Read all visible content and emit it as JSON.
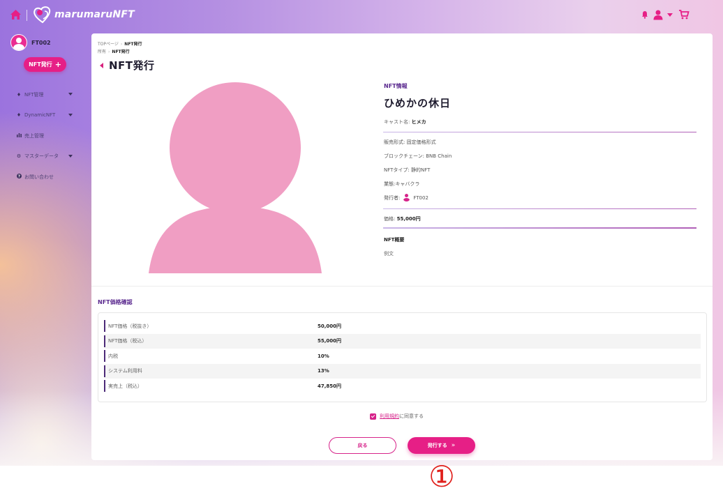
{
  "header": {
    "logo_text": "marumaruNFT",
    "icons": [
      "home-icon",
      "bell-icon",
      "user-icon",
      "cart-icon"
    ],
    "accent_color": "#e61f86"
  },
  "sidebar": {
    "username": "FT002",
    "issue_button_label": "NFT発行",
    "issue_button_icon": "+",
    "items": [
      {
        "label": "NFT管理",
        "icon": "diamond-icon",
        "has_caret": true
      },
      {
        "label": "DynamicNFT",
        "icon": "diamond-icon",
        "has_caret": true
      },
      {
        "label": "売上管理",
        "icon": "bar-chart-icon",
        "has_caret": false
      },
      {
        "label": "マスターデータ",
        "icon": "gear-icon",
        "has_caret": true
      },
      {
        "label": "お問い合わせ",
        "icon": "question-icon",
        "has_caret": false
      }
    ]
  },
  "breadcrumb": {
    "top": "TOPページ",
    "current": "NFT発行",
    "owner_label": "所有",
    "owner_current": "NFT発行"
  },
  "page_title": "NFT発行",
  "nft": {
    "section_heading": "NFT情報",
    "name": "ひめかの休日",
    "cast_label": "キャスト名:",
    "cast_value": "ヒメカ",
    "sale_format": "販売形式: 固定価格形式",
    "blockchain": "ブロックチェーン: BNB Chain",
    "nft_type": "NFTタイプ: 静的NFT",
    "industry": "業態:キャバクラ",
    "issuer_label": "発行者:",
    "issuer_value": "FT002",
    "price_label": "価格:",
    "price_value": "55,000円",
    "summary_heading": "NFT概要",
    "summary_text": "例文",
    "image_color": "#f09ec3"
  },
  "price_confirm": {
    "heading": "NFT価格確認",
    "rows": [
      {
        "label": "NFT価格（税抜き）",
        "value": "50,000円"
      },
      {
        "label": "NFT価格（税込）",
        "value": "55,000円"
      },
      {
        "label": "内税",
        "value": "10%"
      },
      {
        "label": "システム利用料",
        "value": "13%"
      },
      {
        "label": "実売上（税込）",
        "value": "47,850円"
      }
    ]
  },
  "agreement": {
    "checked": true,
    "link_text": "利用規約",
    "suffix": "に同意する"
  },
  "actions": {
    "back_label": "戻る",
    "issue_label": "発行する",
    "issue_icon": "»"
  },
  "annotation": "①"
}
